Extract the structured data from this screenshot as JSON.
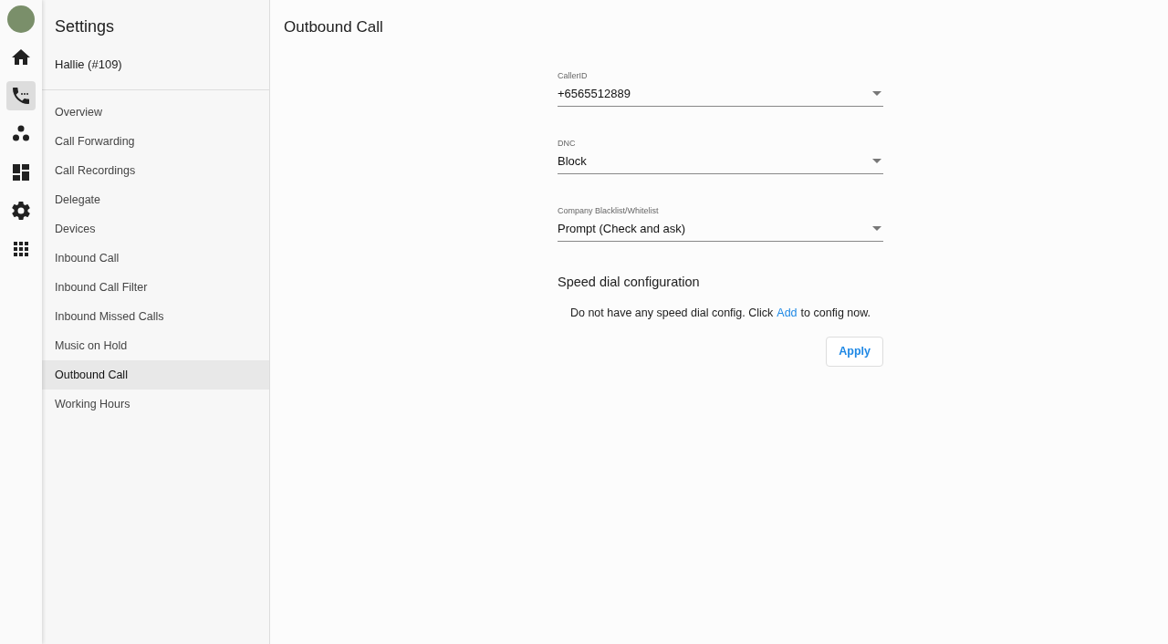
{
  "rail": {
    "items": [
      {
        "kind": "home",
        "selected": false
      },
      {
        "kind": "phone",
        "selected": true
      },
      {
        "kind": "people",
        "selected": false
      },
      {
        "kind": "dashboard",
        "selected": false
      },
      {
        "kind": "settings",
        "selected": false
      },
      {
        "kind": "apps",
        "selected": false
      }
    ]
  },
  "sidebar": {
    "title": "Settings",
    "user": "Hallie (#109)",
    "items": [
      {
        "label": "Overview",
        "selected": false
      },
      {
        "label": "Call Forwarding",
        "selected": false
      },
      {
        "label": "Call Recordings",
        "selected": false
      },
      {
        "label": "Delegate",
        "selected": false
      },
      {
        "label": "Devices",
        "selected": false
      },
      {
        "label": "Inbound Call",
        "selected": false
      },
      {
        "label": "Inbound Call Filter",
        "selected": false
      },
      {
        "label": "Inbound Missed Calls",
        "selected": false
      },
      {
        "label": "Music on Hold",
        "selected": false
      },
      {
        "label": "Outbound Call",
        "selected": true
      },
      {
        "label": "Working Hours",
        "selected": false
      }
    ]
  },
  "main": {
    "title": "Outbound Call",
    "fields": [
      {
        "label": "CallerID",
        "value": "+6565512889"
      },
      {
        "label": "DNC",
        "value": "Block"
      },
      {
        "label": "Company Blacklist/Whitelist",
        "value": "Prompt (Check and ask)"
      }
    ],
    "speed_dial": {
      "heading": "Speed dial configuration",
      "text_before": "Do not have any speed dial config. Click",
      "link": "Add",
      "text_after": "to config now."
    },
    "apply_button": "Apply"
  }
}
